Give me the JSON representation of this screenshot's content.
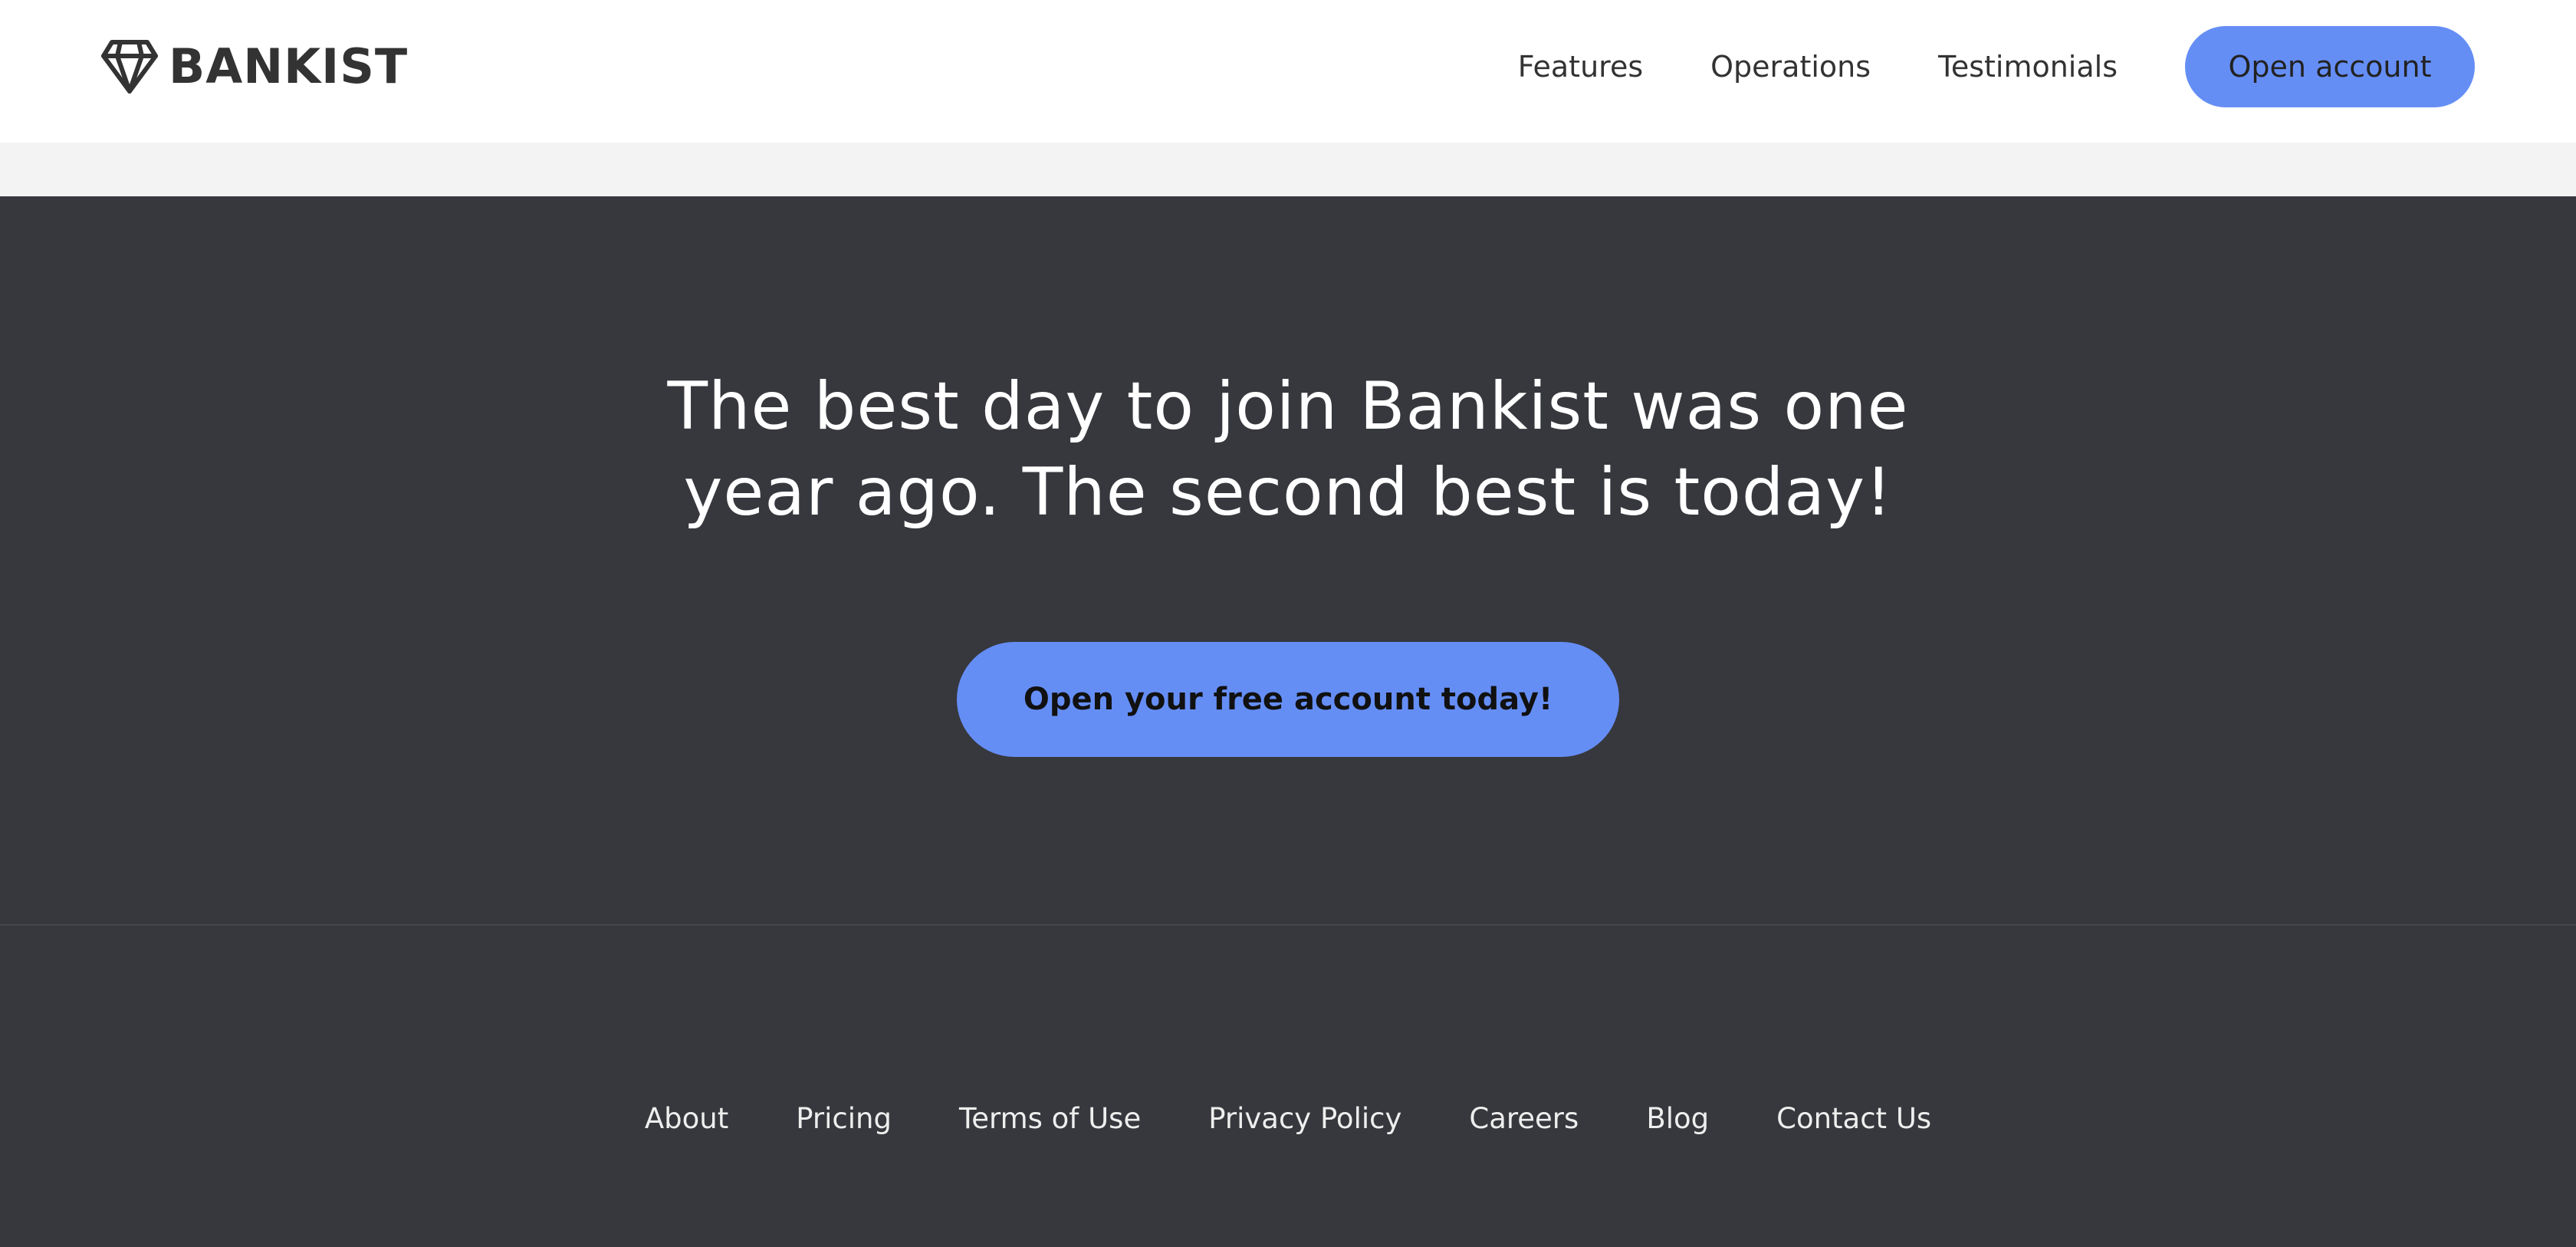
{
  "header": {
    "logo_text": "BANKIST",
    "logo_icon": "diamond-icon",
    "nav": [
      {
        "label": "Features"
      },
      {
        "label": "Operations"
      },
      {
        "label": "Testimonials"
      }
    ],
    "cta_label": "Open account"
  },
  "signup": {
    "heading_line1": "The best day to join Bankist was one",
    "heading_line2": "year ago. The second best is today!",
    "button_label": "Open your free account today!"
  },
  "footer": {
    "links": [
      {
        "label": "About"
      },
      {
        "label": "Pricing"
      },
      {
        "label": "Terms of Use"
      },
      {
        "label": "Privacy Policy"
      },
      {
        "label": "Careers"
      },
      {
        "label": "Blog"
      },
      {
        "label": "Contact Us"
      }
    ]
  },
  "colors": {
    "accent": "#658ef5",
    "dark_background": "#37383d",
    "header_background": "#ffffff",
    "strip_background": "#f3f3f3",
    "text_dark": "#333333",
    "text_light": "#ffffff"
  }
}
